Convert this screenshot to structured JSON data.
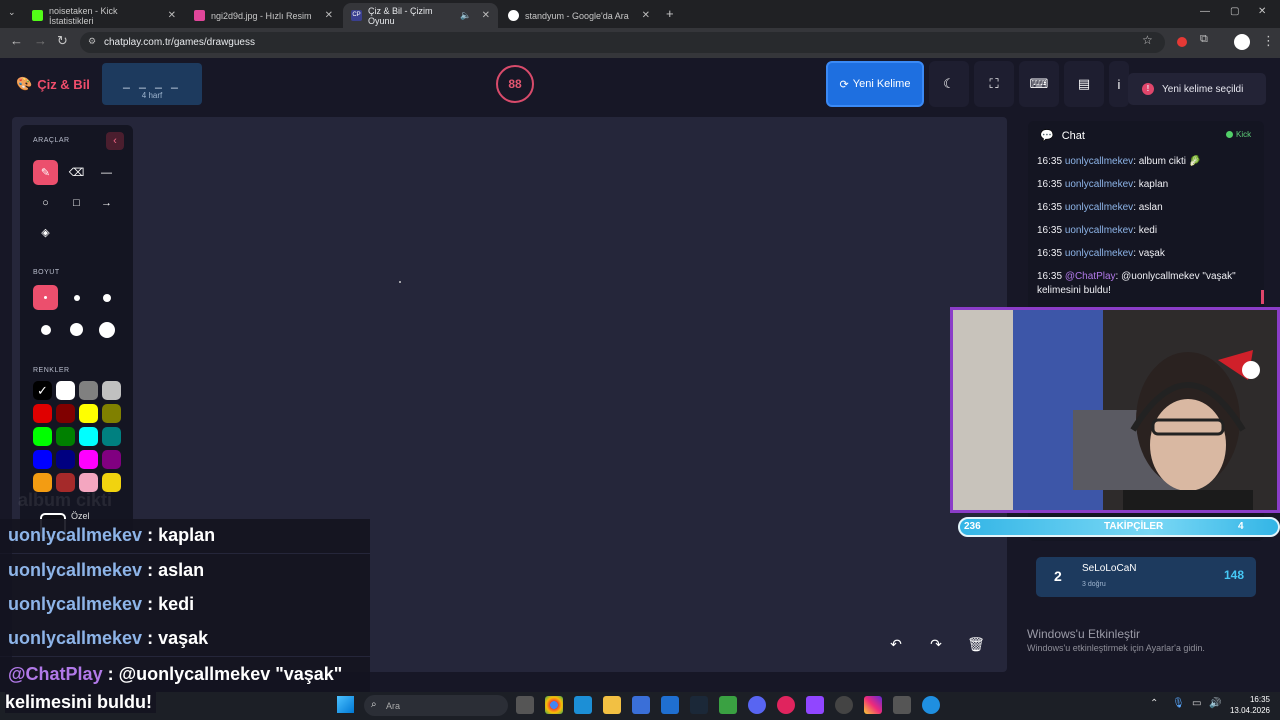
{
  "browser": {
    "tabs": [
      {
        "title": "noisetaken - Kick İstatistikleri",
        "color": "#53fc18"
      },
      {
        "title": "ngi2d9d.jpg - Hızlı Resim",
        "color": "#e0469a"
      },
      {
        "title": "Çiz & Bil - Çizim Oyunu",
        "color": "#3a3f8f"
      },
      {
        "title": "standyum - Google'da Ara",
        "color": "#4285f4"
      }
    ],
    "url": "chatplay.com.tr/games/drawguess"
  },
  "header": {
    "logo": "Çiz & Bil",
    "word_dashes": "_ _ _ _",
    "word_hint": "4 harf",
    "timer": "88",
    "new_word": "Yeni Kelime",
    "toast": "Yeni kelime seçildi"
  },
  "tools": {
    "section_tools": "ARAÇLAR",
    "section_size": "BOYUT",
    "section_colors": "RENKLER",
    "custom_label": "Özel",
    "colors": [
      "#000000",
      "#ffffff",
      "#808080",
      "#c0c0c0",
      "#e00000",
      "#800000",
      "#ffff00",
      "#808000",
      "#00ff00",
      "#008000",
      "#00ffff",
      "#008080",
      "#0000ff",
      "#000080",
      "#ff00ff",
      "#800080",
      "#f39c12",
      "#a52a2a",
      "#f4a6c0",
      "#f1d30f"
    ]
  },
  "chat": {
    "title": "Chat",
    "source": "Kick",
    "messages": [
      {
        "time": "16:35",
        "user": "uonlycallmekev",
        "text": ": album cikti 🥬"
      },
      {
        "time": "16:35",
        "user": "uonlycallmekev",
        "text": ": kaplan"
      },
      {
        "time": "16:35",
        "user": "uonlycallmekev",
        "text": ": aslan"
      },
      {
        "time": "16:35",
        "user": "uonlycallmekev",
        "text": ": kedi"
      },
      {
        "time": "16:35",
        "user": "uonlycallmekev",
        "text": ": vaşak"
      },
      {
        "time": "16:35",
        "user": "@ChatPlay",
        "text": ": @uonlycallmekev \"vaşak\" kelimesini buldu!"
      }
    ]
  },
  "leaderboard": {
    "rank": "2",
    "name": "SeLoLoCaN",
    "sub": "3 doğru",
    "score": "148"
  },
  "overlay": {
    "followers_count": "236",
    "followers_label": "TAKİPÇİLER",
    "followers_right": "4",
    "ghost": "album cikti",
    "rows": [
      {
        "user": "uonlycallmekev",
        "text": " : kaplan"
      },
      {
        "user": "uonlycallmekev",
        "text": " : aslan"
      },
      {
        "user": "uonlycallmekev",
        "text": " : kedi"
      },
      {
        "user": "uonlycallmekev",
        "text": " : vaşak"
      }
    ],
    "last_user": "@ChatPlay",
    "last_text": " : @uonlycallmekev \"vaşak\"",
    "last_text2": "kelimesini buldu!"
  },
  "windows": {
    "activate_title": "Windows'u Etkinleştir",
    "activate_sub": "Windows'u etkinleştirmek için Ayarlar'a gidin.",
    "search": "Ara",
    "time": "16:35",
    "date": "13.04.2026"
  }
}
